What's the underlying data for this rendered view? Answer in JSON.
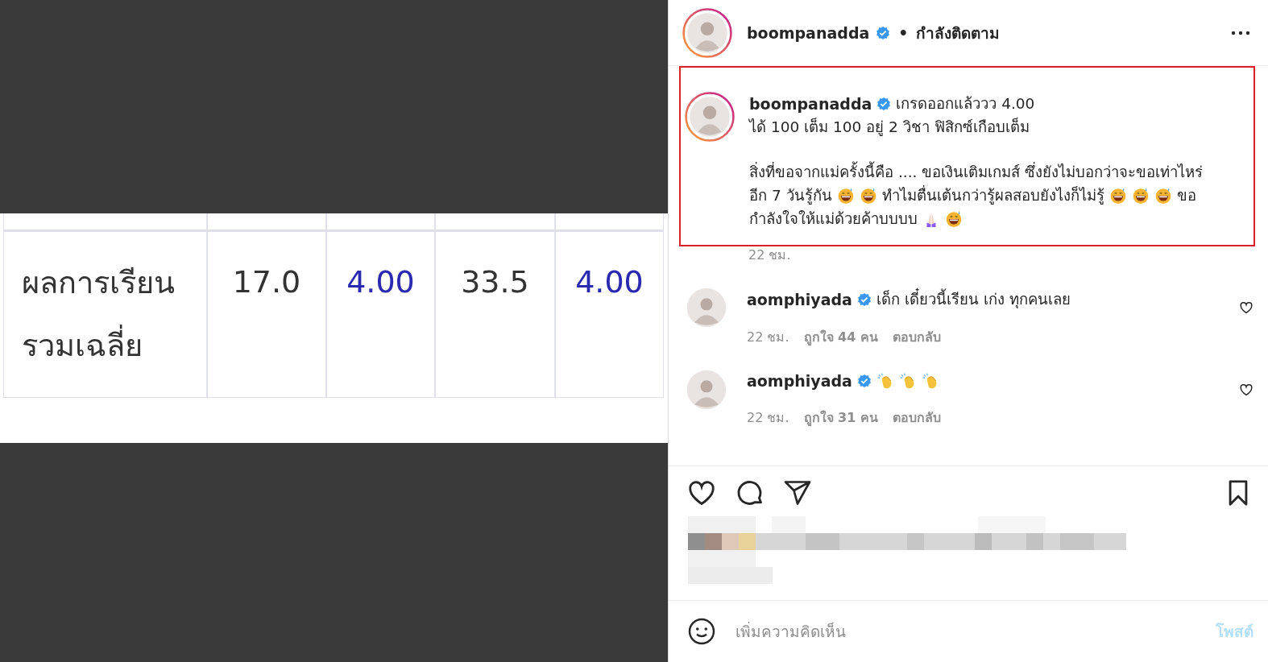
{
  "image": {
    "table": {
      "rows": [
        {
          "label_lines": [
            "ผลการเรียน",
            "รวมเฉลี่ย"
          ],
          "cells": [
            {
              "kind": "score",
              "text": "17.0"
            },
            {
              "kind": "grade",
              "text": "4.00"
            },
            {
              "kind": "score",
              "text": "33.5"
            },
            {
              "kind": "grade",
              "text": "4.00"
            }
          ]
        }
      ]
    }
  },
  "header": {
    "username": "boompanadda",
    "verified": true,
    "separator": "•",
    "follow_status": "กำลังติดตาม",
    "story_ring": true
  },
  "caption": {
    "highlighted": true,
    "username": "boompanadda",
    "verified": true,
    "story_ring": true,
    "time": "22 ชม.",
    "paragraphs": [
      [
        [
          {
            "kind": "text",
            "text": "เกรดออกแล้ววว 4.00"
          }
        ],
        [
          {
            "kind": "text",
            "text": "ได้ 100 เต็ม 100 อยู่ 2 วิชา ฟิสิกซ์เกือบเต็ม"
          }
        ]
      ],
      [
        [
          {
            "kind": "text",
            "text": "สิ่งที่ขอจากแม่ครั้งนี้คือ .... ขอเงินเติมเกมส์ ซึ่งยังไม่บอกว่าจะขอเท่าไหร่"
          }
        ],
        [
          {
            "kind": "text",
            "text": "อีก 7 วันรู้กัน"
          },
          {
            "kind": "grin"
          },
          {
            "kind": "grin"
          },
          {
            "kind": "text",
            "text": "ทำไมตื่นเต้นกว่ารู้ผลสอบยังไงก็ไม่รู้"
          },
          {
            "kind": "grin"
          },
          {
            "kind": "grin"
          },
          {
            "kind": "grin"
          },
          {
            "kind": "text",
            "text": "ขอ"
          }
        ],
        [
          {
            "kind": "text",
            "text": "กำลังใจให้แม่ด้วยค้าบบบบ"
          },
          {
            "kind": "pray"
          },
          {
            "kind": "grin"
          }
        ]
      ]
    ]
  },
  "comments": [
    {
      "username": "aomphiyada",
      "verified": true,
      "parts": [
        {
          "kind": "text",
          "text": "เด็ก เดี๋ยวนี้เรียน เก่ง ทุกคนเลย"
        }
      ],
      "time": "22 ชม.",
      "likes": "ถูกใจ 44 คน",
      "reply": "ตอบกลับ",
      "liked": false
    },
    {
      "username": "aomphiyada",
      "verified": true,
      "parts": [
        {
          "kind": "clap"
        },
        {
          "kind": "clap"
        },
        {
          "kind": "clap"
        }
      ],
      "time": "22 ชม.",
      "likes": "ถูกใจ 31 คน",
      "reply": "ตอบกลับ",
      "liked": false
    }
  ],
  "actions": {
    "liked": false,
    "saved": false
  },
  "comment_box": {
    "placeholder": "เพิ่มความคิดเห็น",
    "post": "โพสต์",
    "post_disabled": true
  }
}
